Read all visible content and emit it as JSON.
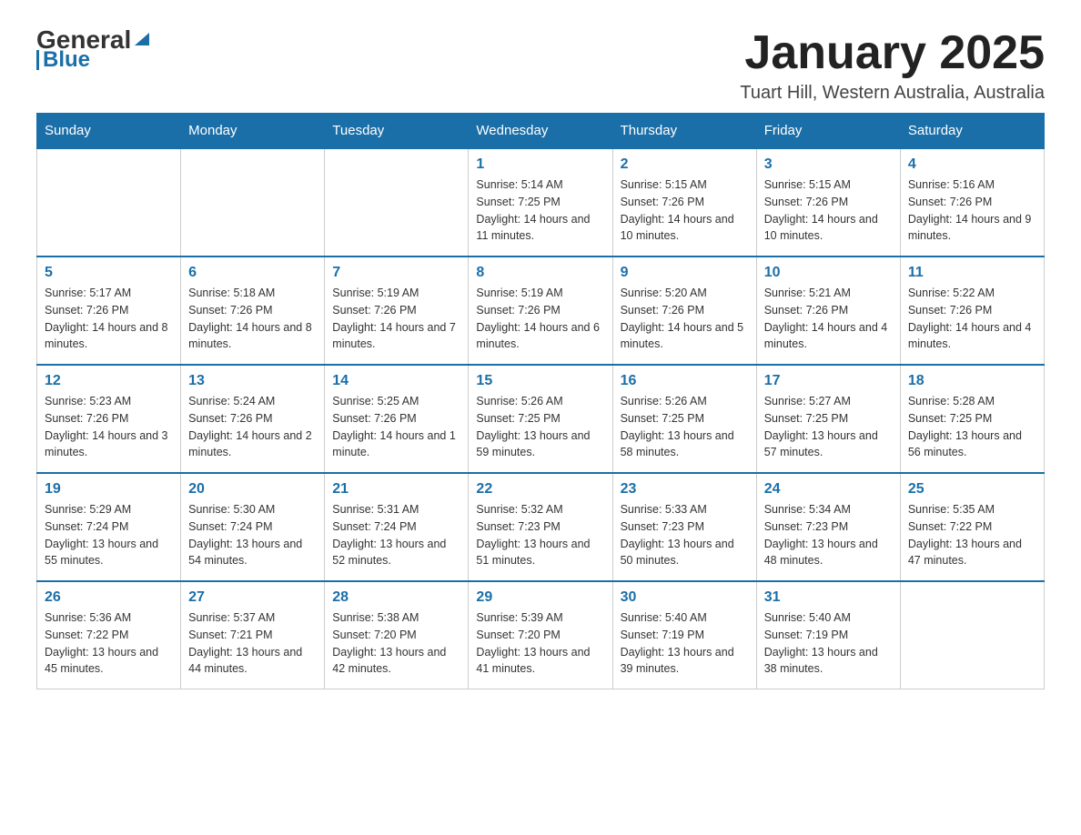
{
  "header": {
    "logo_text_general": "General",
    "logo_text_blue": "Blue",
    "title": "January 2025",
    "subtitle": "Tuart Hill, Western Australia, Australia"
  },
  "days_of_week": [
    "Sunday",
    "Monday",
    "Tuesday",
    "Wednesday",
    "Thursday",
    "Friday",
    "Saturday"
  ],
  "weeks": [
    [
      {
        "day": "",
        "info": ""
      },
      {
        "day": "",
        "info": ""
      },
      {
        "day": "",
        "info": ""
      },
      {
        "day": "1",
        "info": "Sunrise: 5:14 AM\nSunset: 7:25 PM\nDaylight: 14 hours and 11 minutes."
      },
      {
        "day": "2",
        "info": "Sunrise: 5:15 AM\nSunset: 7:26 PM\nDaylight: 14 hours and 10 minutes."
      },
      {
        "day": "3",
        "info": "Sunrise: 5:15 AM\nSunset: 7:26 PM\nDaylight: 14 hours and 10 minutes."
      },
      {
        "day": "4",
        "info": "Sunrise: 5:16 AM\nSunset: 7:26 PM\nDaylight: 14 hours and 9 minutes."
      }
    ],
    [
      {
        "day": "5",
        "info": "Sunrise: 5:17 AM\nSunset: 7:26 PM\nDaylight: 14 hours and 8 minutes."
      },
      {
        "day": "6",
        "info": "Sunrise: 5:18 AM\nSunset: 7:26 PM\nDaylight: 14 hours and 8 minutes."
      },
      {
        "day": "7",
        "info": "Sunrise: 5:19 AM\nSunset: 7:26 PM\nDaylight: 14 hours and 7 minutes."
      },
      {
        "day": "8",
        "info": "Sunrise: 5:19 AM\nSunset: 7:26 PM\nDaylight: 14 hours and 6 minutes."
      },
      {
        "day": "9",
        "info": "Sunrise: 5:20 AM\nSunset: 7:26 PM\nDaylight: 14 hours and 5 minutes."
      },
      {
        "day": "10",
        "info": "Sunrise: 5:21 AM\nSunset: 7:26 PM\nDaylight: 14 hours and 4 minutes."
      },
      {
        "day": "11",
        "info": "Sunrise: 5:22 AM\nSunset: 7:26 PM\nDaylight: 14 hours and 4 minutes."
      }
    ],
    [
      {
        "day": "12",
        "info": "Sunrise: 5:23 AM\nSunset: 7:26 PM\nDaylight: 14 hours and 3 minutes."
      },
      {
        "day": "13",
        "info": "Sunrise: 5:24 AM\nSunset: 7:26 PM\nDaylight: 14 hours and 2 minutes."
      },
      {
        "day": "14",
        "info": "Sunrise: 5:25 AM\nSunset: 7:26 PM\nDaylight: 14 hours and 1 minute."
      },
      {
        "day": "15",
        "info": "Sunrise: 5:26 AM\nSunset: 7:25 PM\nDaylight: 13 hours and 59 minutes."
      },
      {
        "day": "16",
        "info": "Sunrise: 5:26 AM\nSunset: 7:25 PM\nDaylight: 13 hours and 58 minutes."
      },
      {
        "day": "17",
        "info": "Sunrise: 5:27 AM\nSunset: 7:25 PM\nDaylight: 13 hours and 57 minutes."
      },
      {
        "day": "18",
        "info": "Sunrise: 5:28 AM\nSunset: 7:25 PM\nDaylight: 13 hours and 56 minutes."
      }
    ],
    [
      {
        "day": "19",
        "info": "Sunrise: 5:29 AM\nSunset: 7:24 PM\nDaylight: 13 hours and 55 minutes."
      },
      {
        "day": "20",
        "info": "Sunrise: 5:30 AM\nSunset: 7:24 PM\nDaylight: 13 hours and 54 minutes."
      },
      {
        "day": "21",
        "info": "Sunrise: 5:31 AM\nSunset: 7:24 PM\nDaylight: 13 hours and 52 minutes."
      },
      {
        "day": "22",
        "info": "Sunrise: 5:32 AM\nSunset: 7:23 PM\nDaylight: 13 hours and 51 minutes."
      },
      {
        "day": "23",
        "info": "Sunrise: 5:33 AM\nSunset: 7:23 PM\nDaylight: 13 hours and 50 minutes."
      },
      {
        "day": "24",
        "info": "Sunrise: 5:34 AM\nSunset: 7:23 PM\nDaylight: 13 hours and 48 minutes."
      },
      {
        "day": "25",
        "info": "Sunrise: 5:35 AM\nSunset: 7:22 PM\nDaylight: 13 hours and 47 minutes."
      }
    ],
    [
      {
        "day": "26",
        "info": "Sunrise: 5:36 AM\nSunset: 7:22 PM\nDaylight: 13 hours and 45 minutes."
      },
      {
        "day": "27",
        "info": "Sunrise: 5:37 AM\nSunset: 7:21 PM\nDaylight: 13 hours and 44 minutes."
      },
      {
        "day": "28",
        "info": "Sunrise: 5:38 AM\nSunset: 7:20 PM\nDaylight: 13 hours and 42 minutes."
      },
      {
        "day": "29",
        "info": "Sunrise: 5:39 AM\nSunset: 7:20 PM\nDaylight: 13 hours and 41 minutes."
      },
      {
        "day": "30",
        "info": "Sunrise: 5:40 AM\nSunset: 7:19 PM\nDaylight: 13 hours and 39 minutes."
      },
      {
        "day": "31",
        "info": "Sunrise: 5:40 AM\nSunset: 7:19 PM\nDaylight: 13 hours and 38 minutes."
      },
      {
        "day": "",
        "info": ""
      }
    ]
  ]
}
